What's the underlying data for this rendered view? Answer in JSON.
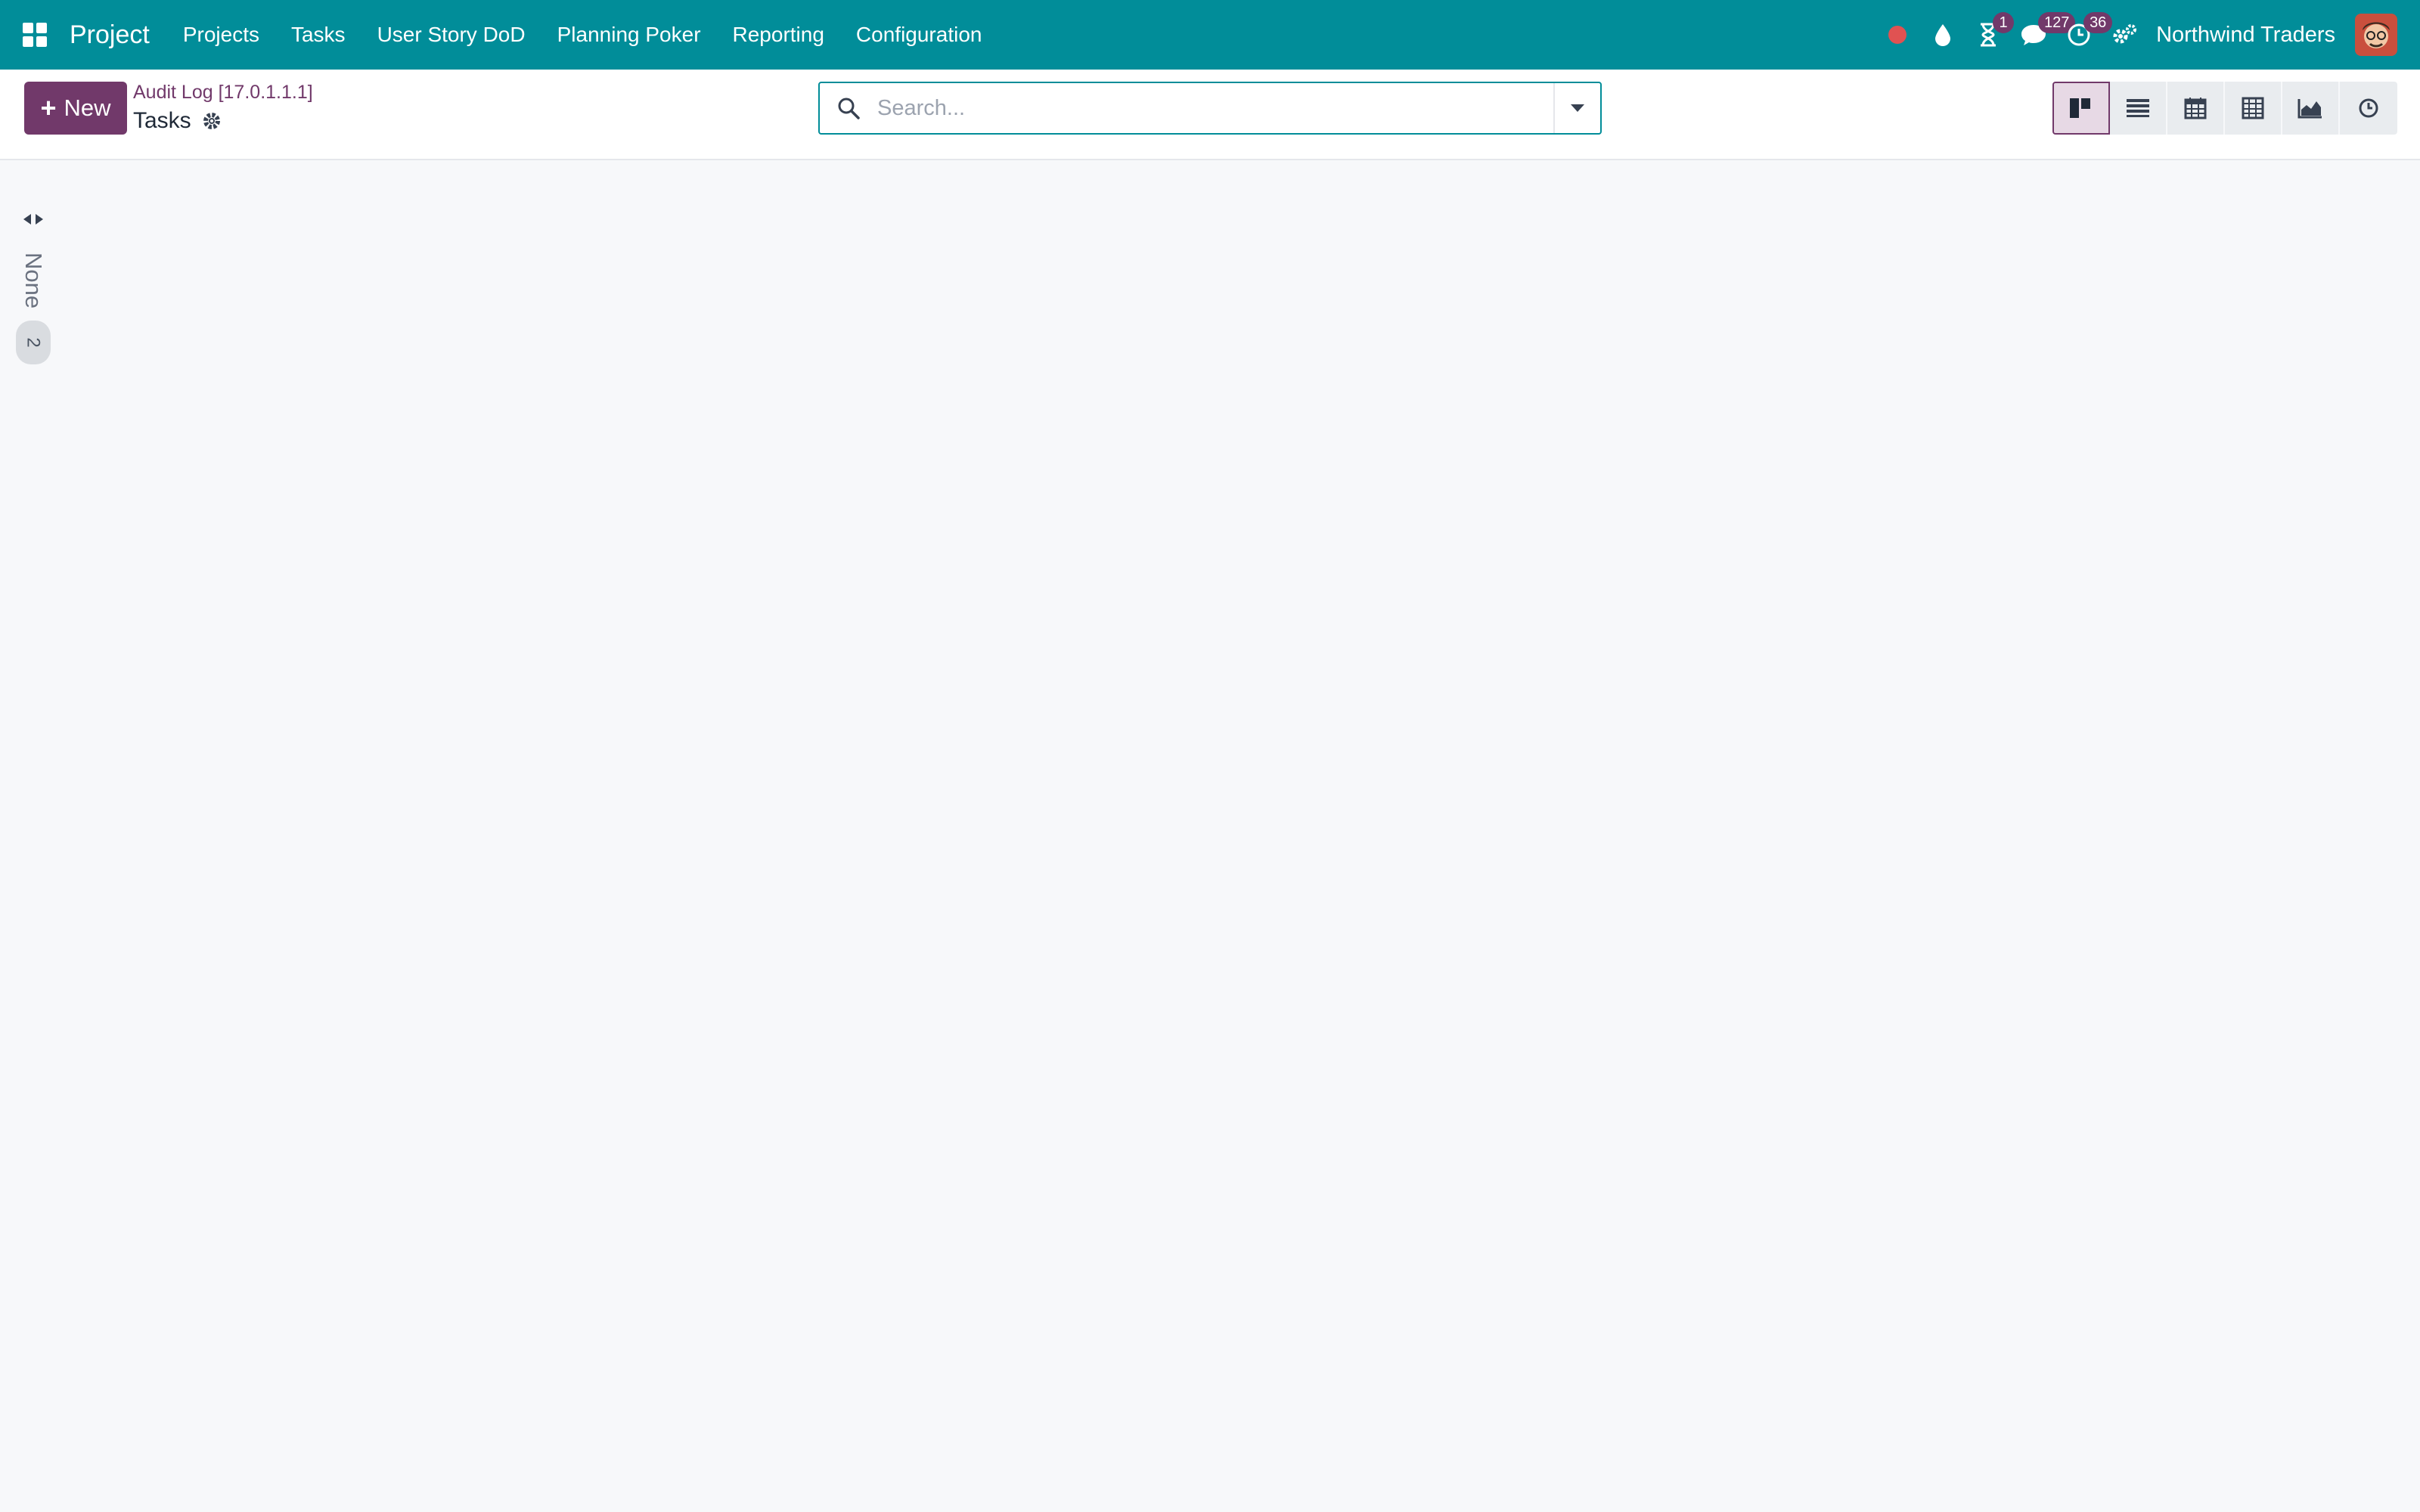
{
  "navbar": {
    "brand": "Project",
    "menu": [
      "Projects",
      "Tasks",
      "User Story DoD",
      "Planning Poker",
      "Reporting",
      "Configuration"
    ],
    "systray": {
      "recording_icon": "record-dot-icon",
      "drop_icon": "drop-icon",
      "activity_badge": "1",
      "messages_badge": "127",
      "clock_badge": "36",
      "settings_icon": "gears-icon"
    },
    "company": "Northwind Traders",
    "colors": {
      "bar": "#018d99",
      "badge": "#71396a",
      "record": "#e05252"
    }
  },
  "control_panel": {
    "new_label": "New",
    "breadcrumb_parent": "Audit Log [17.0.1.1.1]",
    "breadcrumb_current": "Tasks",
    "search_placeholder": "Search...",
    "views": [
      "kanban-icon",
      "list-icon",
      "calendar-icon",
      "pivot-icon",
      "graph-icon",
      "activity-icon"
    ],
    "active_view": "kanban"
  },
  "kanban": {
    "folded_columns": [
      {
        "title": "None",
        "count": "2"
      }
    ]
  }
}
